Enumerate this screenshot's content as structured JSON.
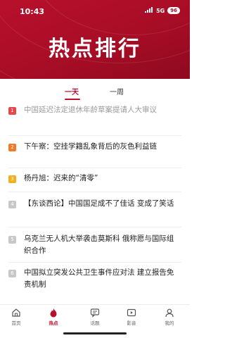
{
  "status_bar": {
    "time": "10:43",
    "network": "5G",
    "battery": "96"
  },
  "header": {
    "title": "热点排行"
  },
  "tabs": [
    {
      "label": "一天",
      "active": true
    },
    {
      "label": "一周",
      "active": false
    }
  ],
  "list": [
    {
      "rank": "1",
      "title": "中国延迟法定退休年龄草案提请人大审议",
      "rank_color": "#e8484a",
      "dim": true
    },
    {
      "rank": "2",
      "title": "下午察：空挂学籍乱象背后的灰色利益链",
      "rank_color": "#f07a2a",
      "dim": false
    },
    {
      "rank": "3",
      "title": "杨丹旭：迟来的“清零”",
      "rank_color": "#f2b01e",
      "dim": false
    },
    {
      "rank": "4",
      "title": "【东谈西论】中国国足成不了佳话 变成了笑话",
      "rank_color": "#c7c7c7",
      "dim": false
    },
    {
      "rank": "5",
      "title": "乌克兰无人机大举袭击莫斯科 俄称愿与国际组织合作",
      "rank_color": "#c7c7c7",
      "dim": false
    },
    {
      "rank": "6",
      "title": "中国拟立突发公共卫生事件应对法 建立报告免责机制",
      "rank_color": "#c7c7c7",
      "dim": false
    }
  ],
  "bottom_nav": [
    {
      "label": "首页",
      "icon": "home-icon",
      "active": false
    },
    {
      "label": "热点",
      "icon": "fire-icon",
      "active": true
    },
    {
      "label": "话题",
      "icon": "chat-icon",
      "active": false
    },
    {
      "label": "影音",
      "icon": "play-icon",
      "active": false
    },
    {
      "label": "我的",
      "icon": "person-icon",
      "active": false
    }
  ],
  "colors": {
    "brand_red": "#b8102c",
    "rank_1": "#e8484a",
    "rank_2": "#f07a2a",
    "rank_3": "#f2b01e",
    "rank_other": "#c7c7c7"
  }
}
